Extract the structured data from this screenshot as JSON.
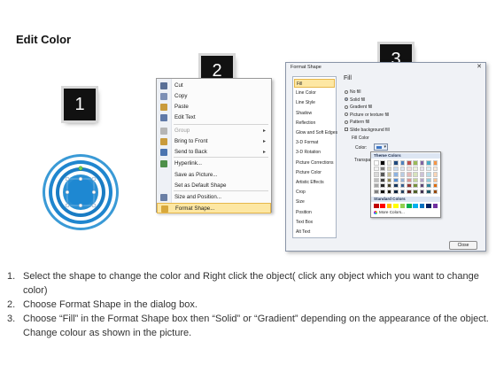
{
  "title": "Edit Color",
  "badges": [
    "1",
    "2",
    "3"
  ],
  "context_menu": {
    "items": [
      {
        "label": "Cut",
        "icon": "scissors-icon",
        "color": "#5a6f96"
      },
      {
        "label": "Copy",
        "icon": "copy-icon",
        "color": "#7c8fb5"
      },
      {
        "label": "Paste",
        "icon": "paste-icon",
        "color": "#c99b3c"
      },
      {
        "label": "Edit Text",
        "icon": "edit-text-icon",
        "color": "#5f79a8"
      },
      {
        "label": "Group",
        "icon": "group-icon",
        "color": "#b5b5b5",
        "disabled": true,
        "submenu": true
      },
      {
        "label": "Bring to Front",
        "icon": "bring-front-icon",
        "color": "#c99b3c",
        "submenu": true
      },
      {
        "label": "Send to Back",
        "icon": "send-back-icon",
        "color": "#4b74b0",
        "submenu": true
      },
      {
        "label": "Hyperlink...",
        "icon": "hyperlink-icon",
        "color": "#4d8f4a"
      },
      {
        "label": "Save as Picture...",
        "icon": "",
        "color": ""
      },
      {
        "label": "Set as Default Shape",
        "icon": "",
        "color": ""
      },
      {
        "label": "Size and Position...",
        "icon": "size-position-icon",
        "color": "#6a7fa5"
      },
      {
        "label": "Format Shape...",
        "icon": "format-shape-icon",
        "color": "#d8a83c",
        "highlighted": true
      }
    ]
  },
  "dialog": {
    "title": "Format Shape",
    "close_x": "✕",
    "categories": [
      "Fill",
      "Line Color",
      "Line Style",
      "Shadow",
      "Reflection",
      "Glow and Soft Edges",
      "3-D Format",
      "3-D Rotation",
      "Picture Corrections",
      "Picture Color",
      "Artistic Effects",
      "Crop",
      "Size",
      "Position",
      "Text Box",
      "Alt Text"
    ],
    "selected_category": "Fill",
    "pane_title": "Fill",
    "fill_options": [
      {
        "label": "No fill",
        "type": "radio",
        "checked": false
      },
      {
        "label": "Solid fill",
        "type": "radio",
        "checked": true
      },
      {
        "label": "Gradient fill",
        "type": "radio",
        "checked": false
      },
      {
        "label": "Picture or texture fill",
        "type": "radio",
        "checked": false
      },
      {
        "label": "Pattern fill",
        "type": "radio",
        "checked": false
      },
      {
        "label": "Slide background fill",
        "type": "checkbox",
        "checked": false
      }
    ],
    "fill_color_header": "Fill Color",
    "color_label": "Color:",
    "transparency_label": "Transpa",
    "close_button": "Close"
  },
  "palette": {
    "theme_header": "Theme Colors",
    "standard_header": "Standard Colors",
    "more_colors": "More Colors...",
    "theme_columns": [
      [
        "#ffffff",
        "#f2f2f2",
        "#d9d9d9",
        "#bfbfbf",
        "#a6a6a6",
        "#808080"
      ],
      [
        "#000000",
        "#7f7f7f",
        "#595959",
        "#404040",
        "#262626",
        "#0d0d0d"
      ],
      [
        "#eeece1",
        "#ddd9c3",
        "#c4bd97",
        "#938953",
        "#494429",
        "#1d1b10"
      ],
      [
        "#1f497d",
        "#c6d9f0",
        "#8db3e2",
        "#548dd4",
        "#17365d",
        "#0f243e"
      ],
      [
        "#4f81bd",
        "#dbe5f1",
        "#b8cce4",
        "#95b3d7",
        "#366092",
        "#244061"
      ],
      [
        "#c0504d",
        "#f2dcdb",
        "#e5b9b7",
        "#d99694",
        "#953734",
        "#632423"
      ],
      [
        "#9bbb59",
        "#ebf1dd",
        "#d7e3bc",
        "#c3d69b",
        "#76923c",
        "#4f6128"
      ],
      [
        "#8064a2",
        "#e5e0ec",
        "#ccc1d9",
        "#b2a2c7",
        "#5f497a",
        "#3f3151"
      ],
      [
        "#4bacc6",
        "#dbeef3",
        "#b7dde8",
        "#92cddc",
        "#31859b",
        "#205867"
      ],
      [
        "#f79646",
        "#fdeada",
        "#fbd5b5",
        "#fac08f",
        "#e36c09",
        "#974806"
      ]
    ],
    "standard_colors": [
      "#c00000",
      "#ff0000",
      "#ffc000",
      "#ffff00",
      "#92d050",
      "#00b050",
      "#00b0f0",
      "#0070c0",
      "#002060",
      "#7030a0"
    ]
  },
  "shape": {
    "ring_colors": [
      "#3a9ad6",
      "#ffffff",
      "#1f86cf",
      "#ffffff",
      "#1a7cc4",
      "#ffffff",
      "#2a8fd3"
    ],
    "center_color": "#1e88d2",
    "handle_color": "#ffffff",
    "rotate_handle_color": "#6fd14f"
  },
  "instructions": [
    {
      "num": "1.",
      "text": "Select the shape to change the color and Right click the object( click any object which you want to change color)"
    },
    {
      "num": "2.",
      "text": "Choose Format Shape in the dialog box."
    },
    {
      "num": "3.",
      "text": "Choose “Fill” in the Format Shape box then “Solid” or “Gradient” depending on the appearance of the object. Change colour as shown in the picture."
    }
  ]
}
